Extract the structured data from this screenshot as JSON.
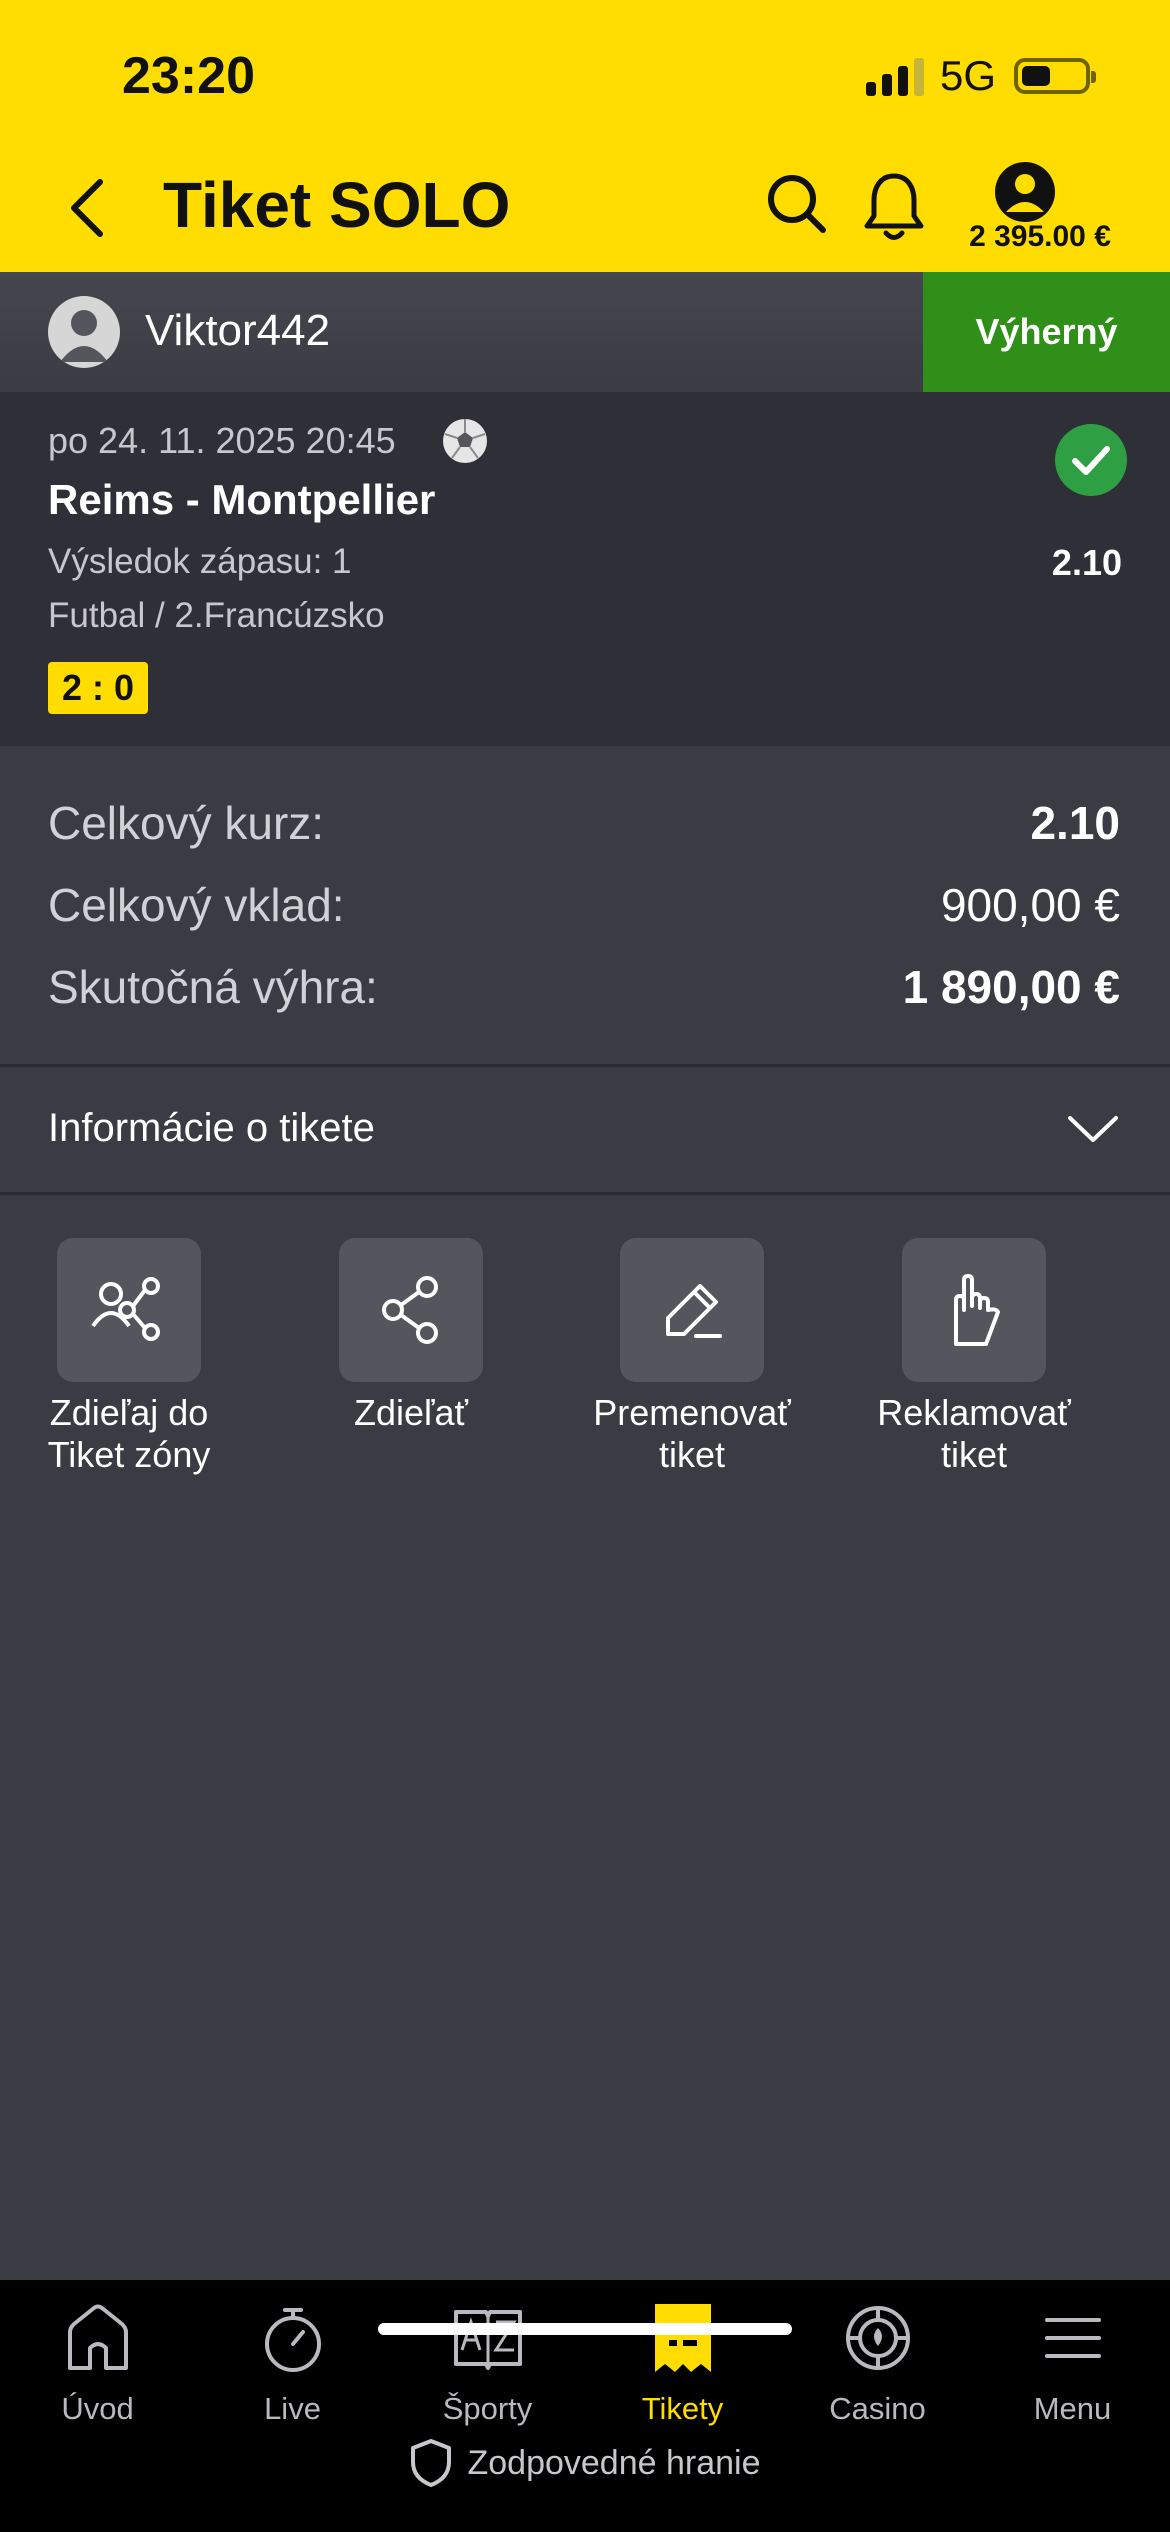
{
  "status_bar": {
    "time": "23:20",
    "network": "5G"
  },
  "header": {
    "title": "Tiket SOLO",
    "balance": "2 395.00 €"
  },
  "user": {
    "name": "Viktor442",
    "status": "Výherný"
  },
  "match": {
    "date": "po 24. 11. 2025 20:45",
    "title": "Reims - Montpellier",
    "market": "Výsledok zápasu: 1",
    "league": "Futbal / 2.Francúzsko",
    "score": "2 : 0",
    "odds": "2.10"
  },
  "summary": {
    "total_odds_label": "Celkový kurz:",
    "total_odds_value": "2.10",
    "total_stake_label": "Celkový vklad:",
    "total_stake_value": "900,00 €",
    "actual_win_label": "Skutočná výhra:",
    "actual_win_value": "1 890,00 €"
  },
  "info": {
    "label": "Informácie o tikete"
  },
  "actions": [
    {
      "line1": "Zdieľaj do",
      "line2": "Tiket zóny",
      "icon": "share-to-zone-icon"
    },
    {
      "line1": "Zdieľať",
      "line2": "",
      "icon": "share-icon"
    },
    {
      "line1": "Premenovať",
      "line2": "tiket",
      "icon": "pencil-icon"
    },
    {
      "line1": "Reklamovať",
      "line2": "tiket",
      "icon": "hand-icon"
    }
  ],
  "nav": {
    "items": [
      {
        "label": "Úvod",
        "icon": "home-icon"
      },
      {
        "label": "Live",
        "icon": "stopwatch-icon"
      },
      {
        "label": "Športy",
        "icon": "az-book-icon"
      },
      {
        "label": "Tikety",
        "icon": "ticket-icon",
        "active": true
      },
      {
        "label": "Casino",
        "icon": "casino-chip-icon"
      },
      {
        "label": "Menu",
        "icon": "hamburger-icon"
      }
    ],
    "responsible": "Zodpovedné hranie"
  },
  "colors": {
    "accent": "#ffdd00",
    "win_green": "#2f8f18",
    "background": "#3a3b43"
  }
}
